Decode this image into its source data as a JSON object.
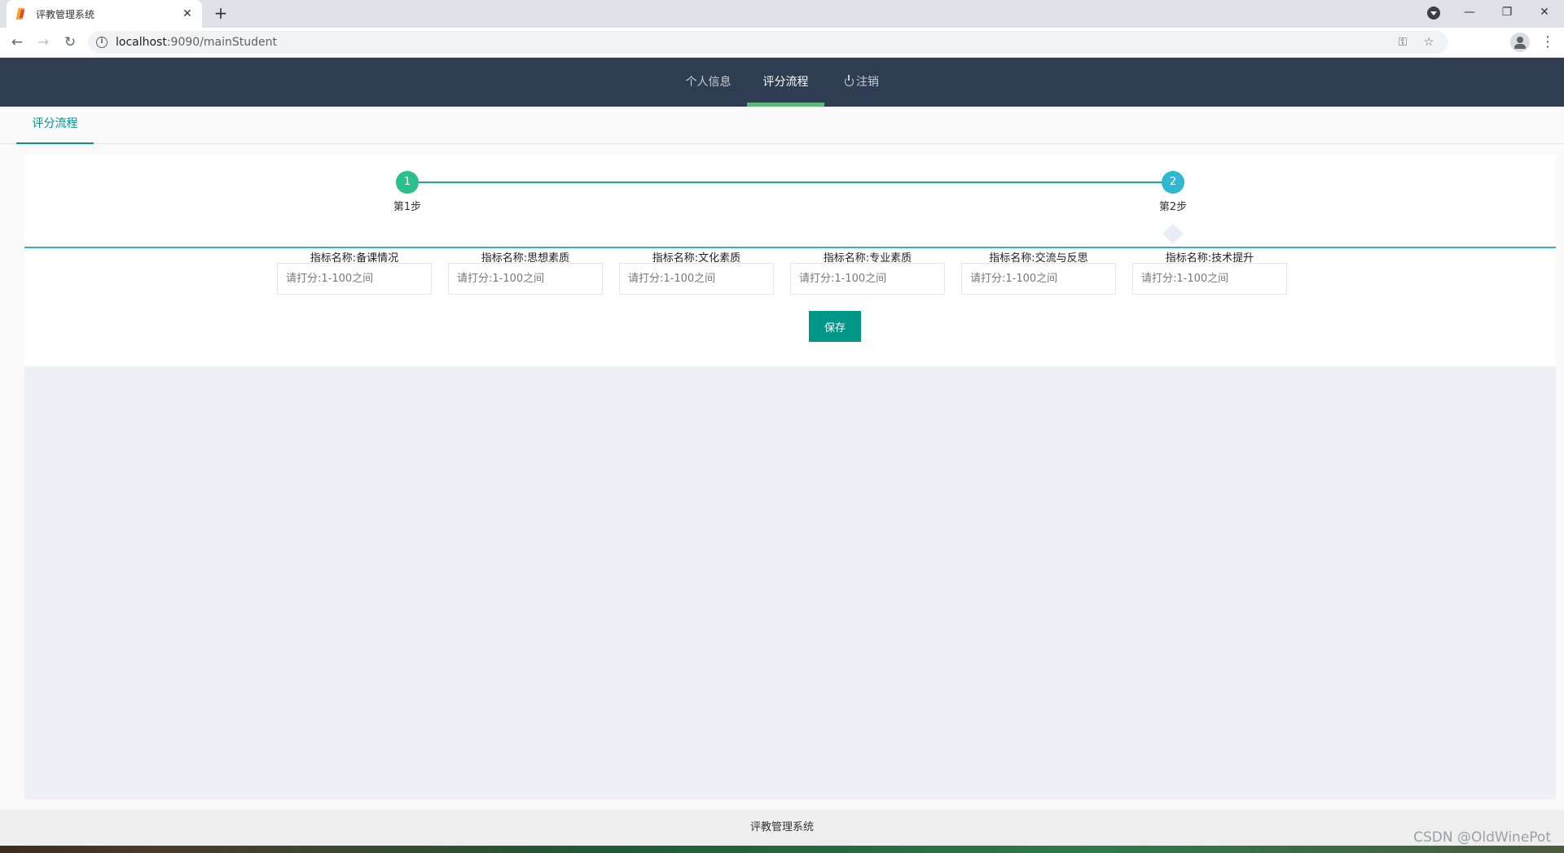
{
  "browser": {
    "tab_title": "评教管理系统",
    "tab_close": "✕",
    "new_tab": "+",
    "url_host": "localhost",
    "url_rest": ":9090/mainStudent",
    "controls": {
      "minimize": "—",
      "restore": "❐",
      "close": "✕"
    }
  },
  "nav": {
    "items": [
      {
        "label": "个人信息"
      },
      {
        "label": "评分流程"
      },
      {
        "label": "注销"
      }
    ],
    "active_index": 1
  },
  "subtab": {
    "label": "评分流程"
  },
  "steps": [
    {
      "number": "1",
      "label": "第1步",
      "color": "#2bbf8a"
    },
    {
      "number": "2",
      "label": "第2步",
      "color": "#2fb8d0"
    }
  ],
  "form": {
    "fields": [
      {
        "label": "指标名称:备课情况",
        "placeholder": "请打分:1-100之间"
      },
      {
        "label": "指标名称:思想素质",
        "placeholder": "请打分:1-100之间"
      },
      {
        "label": "指标名称:文化素质",
        "placeholder": "请打分:1-100之间"
      },
      {
        "label": "指标名称:专业素质",
        "placeholder": "请打分:1-100之间"
      },
      {
        "label": "指标名称:交流与反思",
        "placeholder": "请打分:1-100之间"
      },
      {
        "label": "指标名称:技术提升",
        "placeholder": "请打分:1-100之间"
      }
    ],
    "save_label": "保存"
  },
  "footer": {
    "text": "评教管理系统"
  },
  "watermark": "CSDN @OldWinePot",
  "colors": {
    "header_bg": "#2f3d52",
    "accent": "#009688",
    "nav_active_bar": "#5fb878"
  }
}
